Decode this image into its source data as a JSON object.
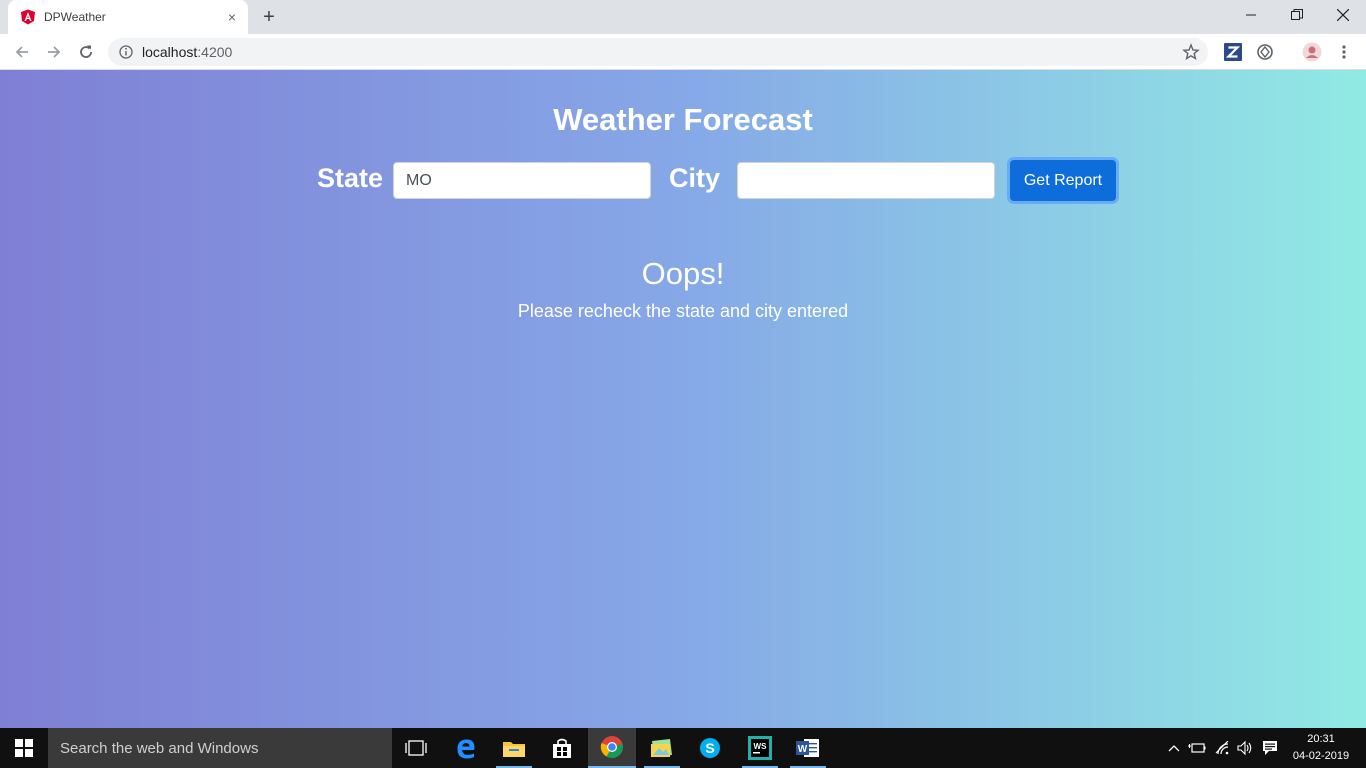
{
  "browser": {
    "tab_title": "DPWeather",
    "tab_close": "×",
    "new_tab": "+",
    "url_host": "localhost",
    "url_port": ":4200"
  },
  "page": {
    "title": "Weather Forecast",
    "state_label": "State",
    "state_value": "MO",
    "city_label": "City",
    "city_value": "",
    "button_label": "Get Report",
    "error_title": "Oops!",
    "error_message": "Please recheck the state and city entered"
  },
  "taskbar": {
    "search_placeholder": "Search the web and Windows",
    "time": "20:31",
    "date": "04-02-2019"
  },
  "colors": {
    "gradient_start": "#7f7fd5",
    "gradient_mid": "#86a8e7",
    "gradient_end": "#91eae4",
    "button": "#0d6edb",
    "angular_red": "#dd0031"
  }
}
